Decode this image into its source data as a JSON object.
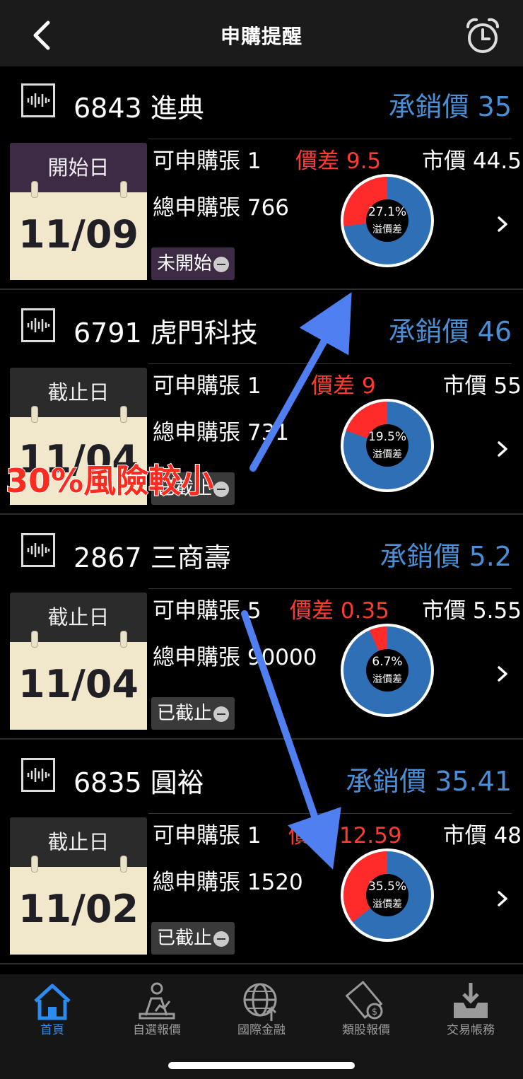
{
  "header": {
    "title": "申購提醒",
    "back_icon": "chevron-left-icon",
    "alarm_icon": "alarm-clock-icon"
  },
  "colors": {
    "accent_blue": "#4a8fd6",
    "spread_red": "#ff3b30",
    "pie_blue": "#2f6fb5",
    "pie_red": "#ff2b2b",
    "tab_active": "#2a8cf0"
  },
  "items": [
    {
      "code_name": "6843 進典",
      "underwriting": "承銷價 35",
      "cal_label": "開始日",
      "date": "11/09",
      "available": "可申購張 1",
      "spread": "價差 9.5",
      "market": "市價 44.5",
      "total": "總申購張 766",
      "status": "未開始",
      "premium_pct": "27.1%",
      "premium_label": "溢價差",
      "premium_value": 0.271
    },
    {
      "code_name": "6791 虎門科技",
      "underwriting": "承銷價 46",
      "cal_label": "截止日",
      "date": "11/04",
      "available": "可申購張 1",
      "spread": "價差 9",
      "market": "市價 55",
      "total": "總申購張 731",
      "status": "已截止",
      "premium_pct": "19.5%",
      "premium_label": "溢價差",
      "premium_value": 0.195
    },
    {
      "code_name": "2867 三商壽",
      "underwriting": "承銷價 5.2",
      "cal_label": "截止日",
      "date": "11/04",
      "available": "可申購張 5",
      "spread": "價差 0.35",
      "market": "市價 5.55",
      "total": "總申購張 90000",
      "status": "已截止",
      "premium_pct": "6.7%",
      "premium_label": "溢價差",
      "premium_value": 0.067
    },
    {
      "code_name": "6835 圓裕",
      "underwriting": "承銷價 35.41",
      "cal_label": "截止日",
      "date": "11/02",
      "available": "可申購張 1",
      "spread": "價差 12.59",
      "market": "市價 48",
      "total": "總申購張 1520",
      "status": "已截止",
      "premium_pct": "35.5%",
      "premium_label": "溢價差",
      "premium_value": 0.355
    }
  ],
  "annotation": {
    "text": "30%風險較小"
  },
  "tabs": [
    {
      "label": "首頁",
      "icon": "home-icon",
      "active": true
    },
    {
      "label": "自選報價",
      "icon": "person-chart-icon",
      "active": false
    },
    {
      "label": "國際金融",
      "icon": "globe-icon",
      "active": false
    },
    {
      "label": "類股報價",
      "icon": "film-coin-icon",
      "active": false
    },
    {
      "label": "交易帳務",
      "icon": "inbox-download-icon",
      "active": false
    }
  ]
}
